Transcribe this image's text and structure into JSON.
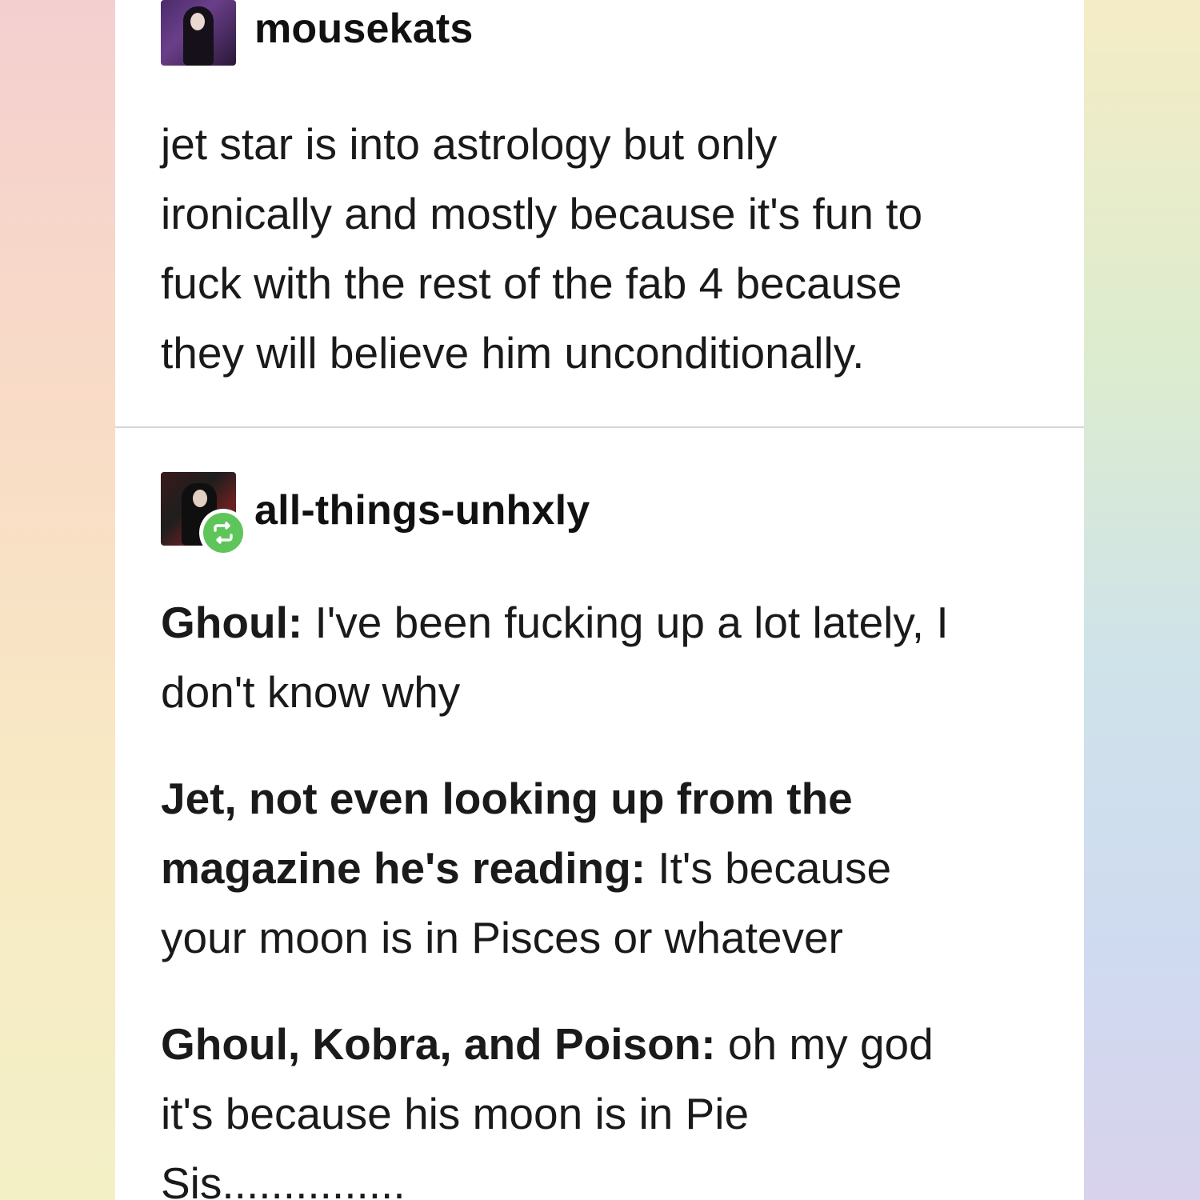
{
  "posts": [
    {
      "username": "mousekats",
      "lines": [
        "jet star is into astrology but only",
        "ironically and mostly because it's fun to",
        "fuck with the rest of the fab 4 because",
        "they will believe him unconditionally."
      ]
    },
    {
      "username": "all-things-unhxly",
      "reblog_icon": "reblog-icon",
      "paragraphs": [
        {
          "speaker": "Ghoul:",
          "line1_rest": " I've been fucking up a lot lately, I",
          "line2": "don't know why"
        },
        {
          "speaker_line1": "Jet, not even looking up from the",
          "speaker_line2": "magazine he's reading:",
          "line2_rest": " It's because",
          "line3": "your moon is in Pisces or whatever"
        },
        {
          "speaker": "Ghoul, Kobra, and Poison:",
          "line1_rest": " oh my god",
          "line2": "it's because his moon is in Pie",
          "line3": "Sis..............."
        }
      ]
    }
  ],
  "colors": {
    "reblog_green": "#5ec55a",
    "text": "#1a1a1a",
    "card": "#ffffff"
  }
}
